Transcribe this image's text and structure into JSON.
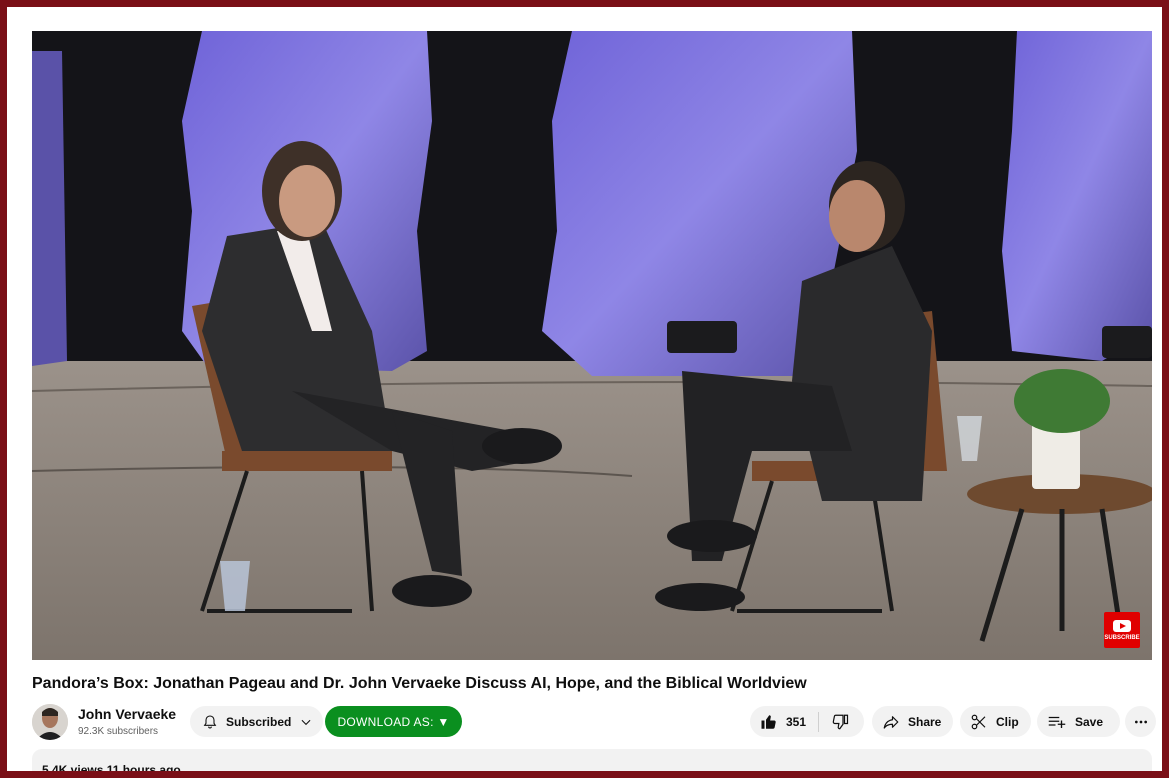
{
  "video": {
    "title": "Pandora’s Box: Jonathan Pageau and Dr. John Vervaeke Discuss AI, Hope, and the Biblical Worldview",
    "badge_label": "SUBSCRIBE"
  },
  "channel": {
    "name": "John Vervaeke",
    "subscribers": "92.3K subscribers"
  },
  "actions": {
    "subscribed_label": "Subscribed",
    "download_label": "DOWNLOAD AS: ▼",
    "like_count": "351",
    "share_label": "Share",
    "clip_label": "Clip",
    "save_label": "Save"
  },
  "description": {
    "meta": "5.4K views  11 hours ago"
  },
  "icons": [
    "bell-icon",
    "chevron-down-icon",
    "thumbs-up-icon",
    "thumbs-down-icon",
    "share-icon",
    "scissors-icon",
    "playlist-add-icon",
    "more-icon"
  ],
  "colors": {
    "border": "#7a0f17",
    "download_button": "#0a8f1f",
    "subscribe_badge": "#e00000",
    "pill_background": "#f2f2f2"
  }
}
